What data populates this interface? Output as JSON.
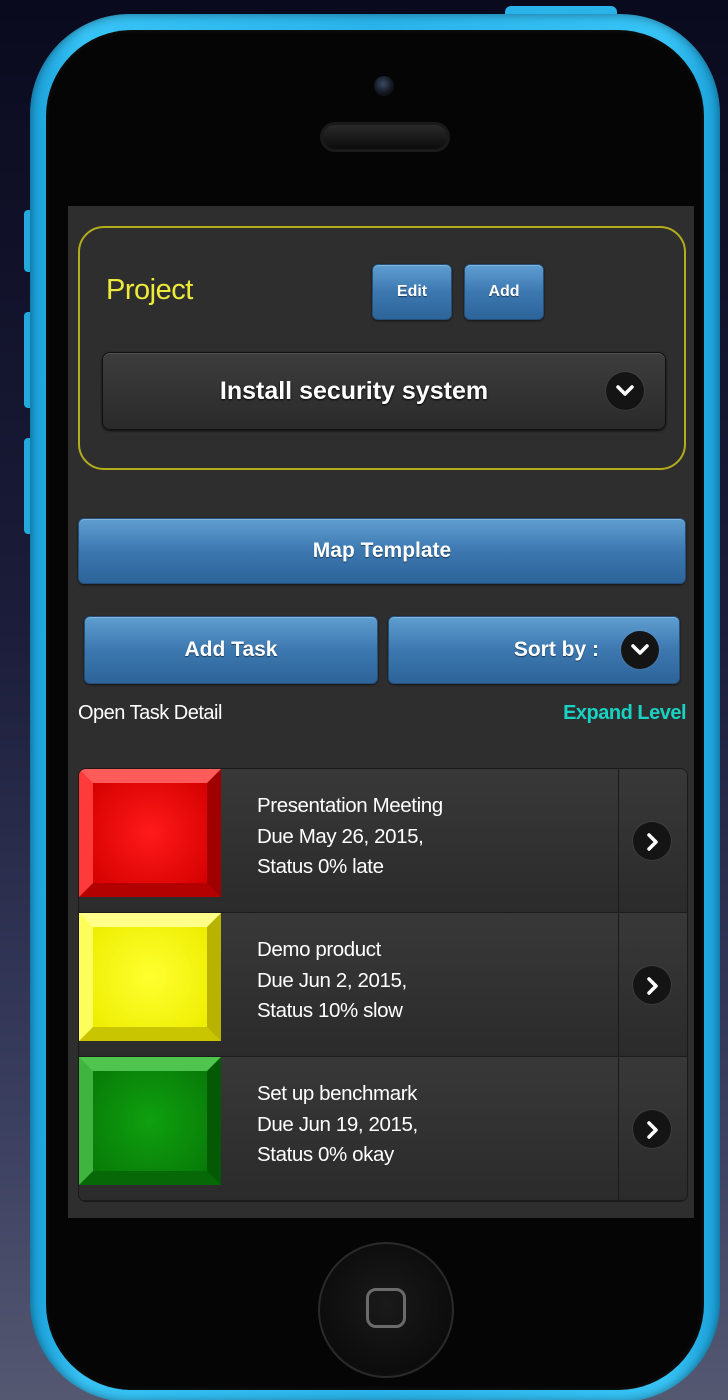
{
  "project": {
    "label": "Project",
    "edit_label": "Edit",
    "add_label": "Add",
    "selected": "Install security system"
  },
  "actions": {
    "map_template": "Map Template",
    "add_task": "Add Task",
    "sort_by": "Sort by :"
  },
  "links": {
    "open_task_detail": "Open Task Detail",
    "expand_level": "Expand Level"
  },
  "tasks": [
    {
      "title": "Presentation Meeting",
      "due": "Due May 26, 2015,",
      "status": "Status 0% late",
      "color": "#e00000"
    },
    {
      "title": "Demo product",
      "due": "Due Jun 2, 2015,",
      "status": "Status 10% slow",
      "color": "#f2f20a"
    },
    {
      "title": "Set up benchmark",
      "due": "Due Jun 19, 2015,",
      "status": "Status 0% okay",
      "color": "#0a8c0a"
    }
  ],
  "colors": {
    "accent_blue": "#3c78b0",
    "project_label": "#eeea3a",
    "project_border": "#b3ad1c",
    "expand_level": "#18d2c4",
    "phone_frame": "#2ab3ea"
  },
  "icons": [
    "chevron-down-icon",
    "chevron-right-icon",
    "camera-icon",
    "speaker-icon",
    "home-button-icon"
  ]
}
